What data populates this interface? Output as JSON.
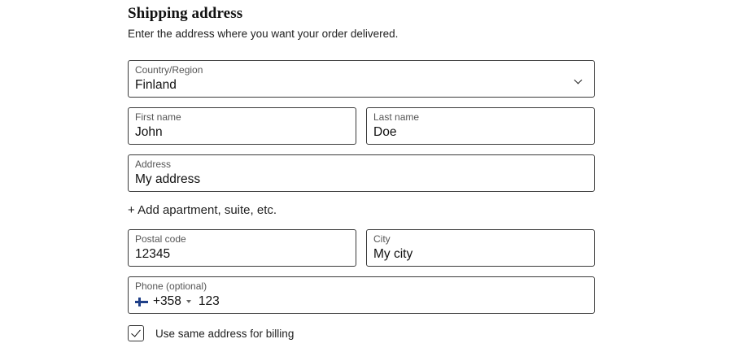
{
  "section": {
    "title": "Shipping address",
    "subtitle": "Enter the address where you want your order delivered."
  },
  "form": {
    "country": {
      "label": "Country/Region",
      "value": "Finland",
      "icon": "chevron-down-icon"
    },
    "first_name": {
      "label": "First name",
      "value": "John"
    },
    "last_name": {
      "label": "Last name",
      "value": "Doe"
    },
    "address": {
      "label": "Address",
      "value": "My address"
    },
    "add_apartment_label": "+ Add apartment, suite, etc.",
    "postal_code": {
      "label": "Postal code",
      "value": "12345"
    },
    "city": {
      "label": "City",
      "value": "My city"
    },
    "phone": {
      "label": "Phone (optional)",
      "country_flag": "finland-flag-icon",
      "dial_code": "+358",
      "number": "123"
    },
    "billing_checkbox": {
      "label": "Use same address for billing",
      "checked": true
    }
  },
  "colors": {
    "border": "#3a3a3a",
    "text": "#1f1f1f",
    "label": "#555555",
    "flag_blue": "#1f3f88"
  }
}
